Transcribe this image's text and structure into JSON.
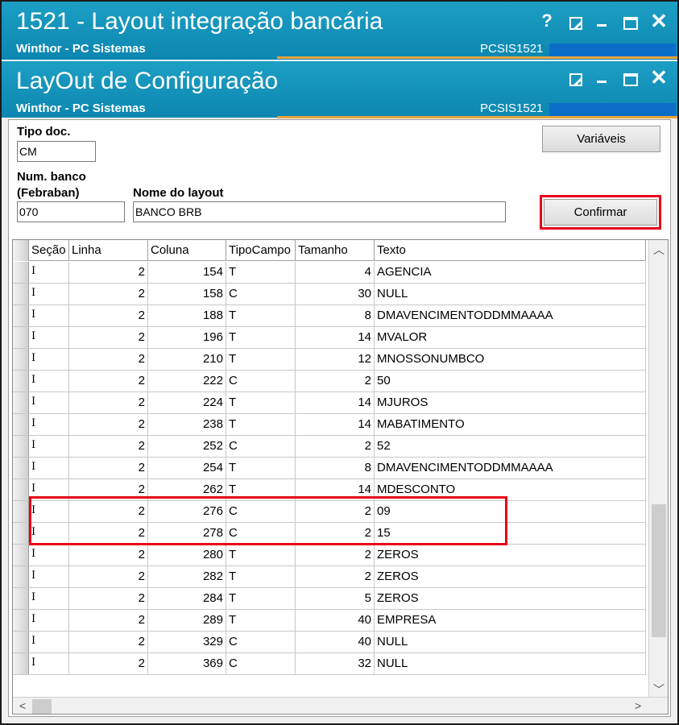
{
  "window1": {
    "title": "1521 - Layout integração bancária",
    "subtitle": "Winthor - PC Sistemas",
    "code": "PCSIS1521",
    "help_icon": "?"
  },
  "window2": {
    "title": "LayOut de Configuração",
    "subtitle": "Winthor - PC Sistemas",
    "code": "PCSIS1521"
  },
  "form": {
    "tipo_doc_label": "Tipo doc.",
    "tipo_doc_value": "CM",
    "num_banco_label_1": "Num. banco",
    "num_banco_label_2": "(Febraban)",
    "num_banco_value": "070",
    "nome_layout_label": "Nome do layout",
    "nome_layout_value": "BANCO BRB",
    "variaveis_button": "Variáveis",
    "confirmar_button": "Confirmar"
  },
  "grid": {
    "columns": [
      "Seção",
      "Linha",
      "Coluna",
      "TipoCampo",
      "Tamanho",
      "Texto"
    ],
    "rows": [
      {
        "secao": "I",
        "linha": "2",
        "coluna": "154",
        "tipo": "T",
        "tamanho": "4",
        "texto": "AGENCIA"
      },
      {
        "secao": "I",
        "linha": "2",
        "coluna": "158",
        "tipo": "C",
        "tamanho": "30",
        "texto": "NULL"
      },
      {
        "secao": "I",
        "linha": "2",
        "coluna": "188",
        "tipo": "T",
        "tamanho": "8",
        "texto": "DMAVENCIMENTODDMMAAAA"
      },
      {
        "secao": "I",
        "linha": "2",
        "coluna": "196",
        "tipo": "T",
        "tamanho": "14",
        "texto": "MVALOR"
      },
      {
        "secao": "I",
        "linha": "2",
        "coluna": "210",
        "tipo": "T",
        "tamanho": "12",
        "texto": "MNOSSONUMBCO"
      },
      {
        "secao": "I",
        "linha": "2",
        "coluna": "222",
        "tipo": "C",
        "tamanho": "2",
        "texto": "50"
      },
      {
        "secao": "I",
        "linha": "2",
        "coluna": "224",
        "tipo": "T",
        "tamanho": "14",
        "texto": "MJUROS"
      },
      {
        "secao": "I",
        "linha": "2",
        "coluna": "238",
        "tipo": "T",
        "tamanho": "14",
        "texto": "MABATIMENTO"
      },
      {
        "secao": "I",
        "linha": "2",
        "coluna": "252",
        "tipo": "C",
        "tamanho": "2",
        "texto": "52"
      },
      {
        "secao": "I",
        "linha": "2",
        "coluna": "254",
        "tipo": "T",
        "tamanho": "8",
        "texto": "DMAVENCIMENTODDMMAAAA"
      },
      {
        "secao": "I",
        "linha": "2",
        "coluna": "262",
        "tipo": "T",
        "tamanho": "14",
        "texto": "MDESCONTO"
      },
      {
        "secao": "I",
        "linha": "2",
        "coluna": "276",
        "tipo": "C",
        "tamanho": "2",
        "texto": "09"
      },
      {
        "secao": "I",
        "linha": "2",
        "coluna": "278",
        "tipo": "C",
        "tamanho": "2",
        "texto": "15"
      },
      {
        "secao": "I",
        "linha": "2",
        "coluna": "280",
        "tipo": "T",
        "tamanho": "2",
        "texto": "ZEROS"
      },
      {
        "secao": "I",
        "linha": "2",
        "coluna": "282",
        "tipo": "T",
        "tamanho": "2",
        "texto": "ZEROS"
      },
      {
        "secao": "I",
        "linha": "2",
        "coluna": "284",
        "tipo": "T",
        "tamanho": "5",
        "texto": "ZEROS"
      },
      {
        "secao": "I",
        "linha": "2",
        "coluna": "289",
        "tipo": "T",
        "tamanho": "40",
        "texto": "EMPRESA"
      },
      {
        "secao": "I",
        "linha": "2",
        "coluna": "329",
        "tipo": "C",
        "tamanho": "40",
        "texto": "NULL"
      },
      {
        "secao": "I",
        "linha": "2",
        "coluna": "369",
        "tipo": "C",
        "tamanho": "32",
        "texto": "NULL"
      }
    ]
  },
  "colors": {
    "titlebar": "#1d9fc4",
    "highlight": "#e8001a",
    "accent_line": "#e8a33a"
  }
}
